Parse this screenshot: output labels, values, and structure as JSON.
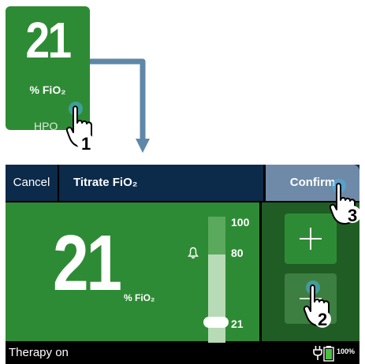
{
  "tile": {
    "value": "21",
    "unit": "% FiO₂",
    "mode": "HPO"
  },
  "header": {
    "cancel_label": "Cancel",
    "title": "Titrate FiO₂",
    "confirm_label": "Confirm"
  },
  "main": {
    "value": "21",
    "unit": "% FiO₂"
  },
  "gauge": {
    "max_label": "100",
    "alarm_label": "80",
    "current_label": "21",
    "current_value": 21
  },
  "status": {
    "text": "Therapy on",
    "battery": "100%"
  },
  "steps": {
    "step1": "1",
    "step2": "2",
    "step3": "3"
  },
  "colors": {
    "accent_green": "#2e8b35",
    "header_navy": "#0c2a4a",
    "confirm_blue": "#6e8aa8"
  },
  "icons": [
    "bell-icon",
    "plus-icon",
    "minus-icon",
    "plug-icon",
    "battery-icon",
    "pointer-hand-icon"
  ]
}
